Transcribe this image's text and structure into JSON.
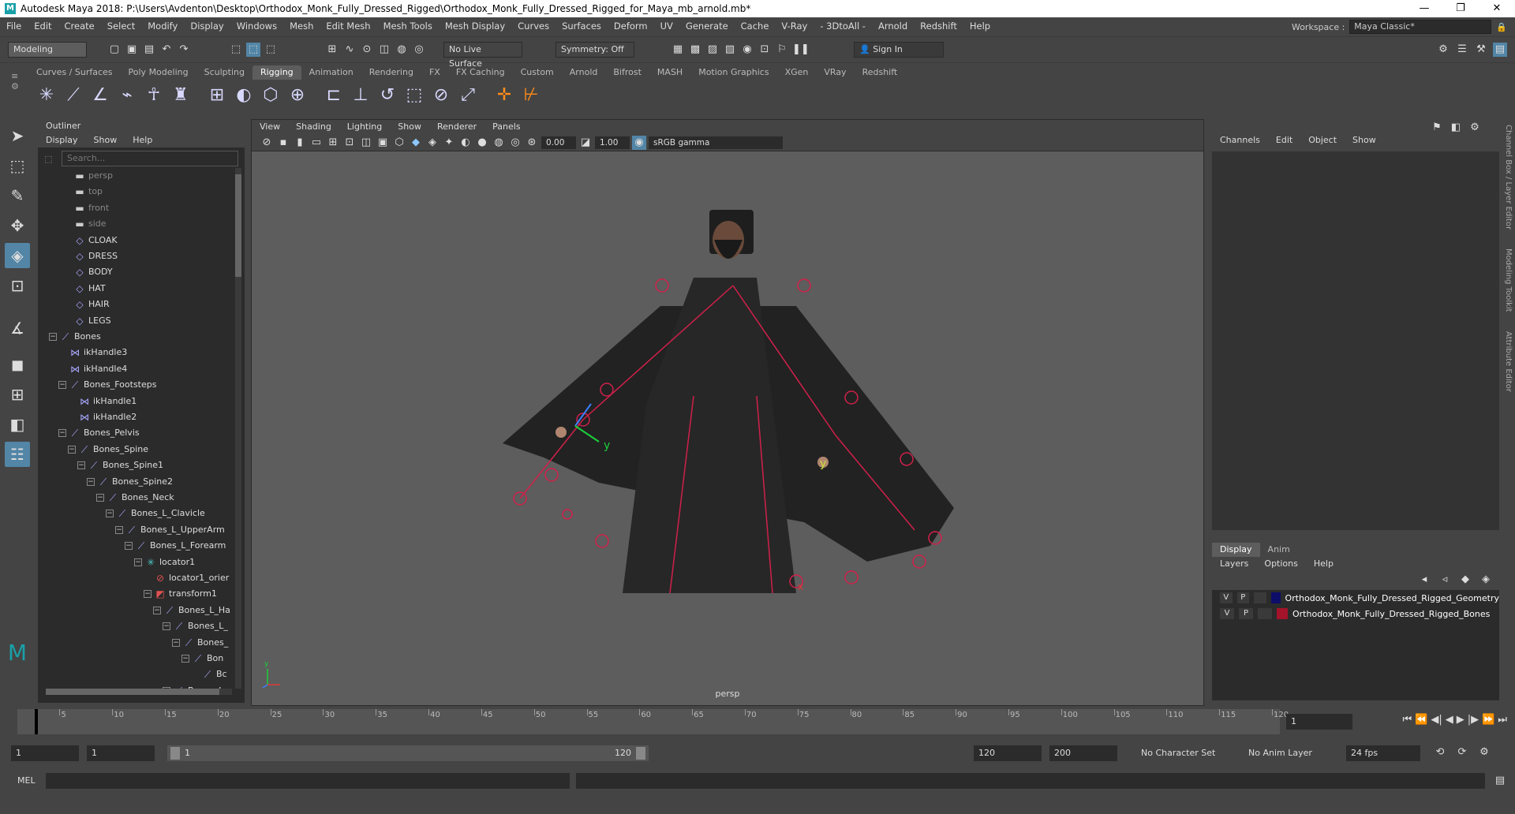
{
  "window": {
    "title": "Autodesk Maya 2018: P:\\Users\\Avdenton\\Desktop\\Orthodox_Monk_Fully_Dressed_Rigged\\Orthodox_Monk_Fully_Dressed_Rigged_for_Maya_mb_arnold.mb*",
    "minimize": "—",
    "maximize": "❐",
    "close": "✕"
  },
  "menubar": [
    "File",
    "Edit",
    "Create",
    "Select",
    "Modify",
    "Display",
    "Windows",
    "Mesh",
    "Edit Mesh",
    "Mesh Tools",
    "Mesh Display",
    "Curves",
    "Surfaces",
    "Deform",
    "UV",
    "Generate",
    "Cache",
    "V-Ray",
    "- 3DtoAll -",
    "Arnold",
    "Redshift",
    "Help"
  ],
  "workspace": {
    "label": "Workspace :",
    "value": "Maya Classic*"
  },
  "status": {
    "mode": "Modeling",
    "live_surface": "No Live Surface",
    "symmetry": "Symmetry: Off",
    "sign_in": "Sign In"
  },
  "shelf_tabs": [
    "Curves / Surfaces",
    "Poly Modeling",
    "Sculpting",
    "Rigging",
    "Animation",
    "Rendering",
    "FX",
    "FX Caching",
    "Custom",
    "Arnold",
    "Bifrost",
    "MASH",
    "Motion Graphics",
    "XGen",
    "VRay",
    "Redshift"
  ],
  "shelf_active": "Rigging",
  "outliner": {
    "title": "Outliner",
    "menu": [
      "Display",
      "Show",
      "Help"
    ],
    "search_placeholder": "Search...",
    "items": [
      {
        "label": "persp",
        "indent": 0,
        "kind": "camera"
      },
      {
        "label": "top",
        "indent": 0,
        "kind": "camera"
      },
      {
        "label": "front",
        "indent": 0,
        "kind": "camera"
      },
      {
        "label": "side",
        "indent": 0,
        "kind": "camera"
      },
      {
        "label": "CLOAK",
        "indent": 0,
        "kind": "mesh"
      },
      {
        "label": "DRESS",
        "indent": 0,
        "kind": "mesh"
      },
      {
        "label": "BODY",
        "indent": 0,
        "kind": "mesh"
      },
      {
        "label": "HAT",
        "indent": 0,
        "kind": "mesh"
      },
      {
        "label": "HAIR",
        "indent": 0,
        "kind": "mesh"
      },
      {
        "label": "LEGS",
        "indent": 0,
        "kind": "mesh"
      },
      {
        "label": "Bones",
        "indent": 0,
        "kind": "joint",
        "exp": "−"
      },
      {
        "label": "ikHandle3",
        "indent": 1,
        "kind": "ik"
      },
      {
        "label": "ikHandle4",
        "indent": 1,
        "kind": "ik"
      },
      {
        "label": "Bones_Footsteps",
        "indent": 1,
        "kind": "joint",
        "exp": "−"
      },
      {
        "label": "ikHandle1",
        "indent": 2,
        "kind": "ik"
      },
      {
        "label": "ikHandle2",
        "indent": 2,
        "kind": "ik"
      },
      {
        "label": "Bones_Pelvis",
        "indent": 1,
        "kind": "joint",
        "exp": "−"
      },
      {
        "label": "Bones_Spine",
        "indent": 2,
        "kind": "joint",
        "exp": "−"
      },
      {
        "label": "Bones_Spine1",
        "indent": 3,
        "kind": "joint",
        "exp": "−"
      },
      {
        "label": "Bones_Spine2",
        "indent": 4,
        "kind": "joint",
        "exp": "−"
      },
      {
        "label": "Bones_Neck",
        "indent": 5,
        "kind": "joint",
        "exp": "−"
      },
      {
        "label": "Bones_L_Clavicle",
        "indent": 6,
        "kind": "joint",
        "exp": "−"
      },
      {
        "label": "Bones_L_UpperArm",
        "indent": 7,
        "kind": "joint",
        "exp": "−"
      },
      {
        "label": "Bones_L_Forearm",
        "indent": 8,
        "kind": "joint",
        "exp": "−"
      },
      {
        "label": "locator1",
        "indent": 9,
        "kind": "locator",
        "exp": "−"
      },
      {
        "label": "locator1_orier",
        "indent": 10,
        "kind": "constraint"
      },
      {
        "label": "transform1",
        "indent": 10,
        "kind": "transform",
        "exp": "−"
      },
      {
        "label": "Bones_L_Ha",
        "indent": 11,
        "kind": "joint",
        "exp": "−"
      },
      {
        "label": "Bones_L_",
        "indent": 12,
        "kind": "joint",
        "exp": "−"
      },
      {
        "label": "Bones_",
        "indent": 13,
        "kind": "joint",
        "exp": "−"
      },
      {
        "label": "Bon",
        "indent": 14,
        "kind": "joint",
        "exp": "−"
      },
      {
        "label": "Bc",
        "indent": 15,
        "kind": "joint"
      },
      {
        "label": "Bones_L_",
        "indent": 12,
        "kind": "joint",
        "exp": "−"
      }
    ]
  },
  "viewport": {
    "menu": [
      "View",
      "Shading",
      "Lighting",
      "Show",
      "Renderer",
      "Panels"
    ],
    "exposure": "0.00",
    "gamma": "1.00",
    "color_space": "sRGB gamma",
    "camera_label": "persp",
    "axis_y": "y",
    "axis_x": "x"
  },
  "channelbox": {
    "menu": [
      "Channels",
      "Edit",
      "Object",
      "Show"
    ],
    "layer_tabs": [
      "Display",
      "Anim"
    ],
    "layer_menu": [
      "Layers",
      "Options",
      "Help"
    ],
    "layers": [
      {
        "v": "V",
        "p": "P",
        "color": "#0d0d6a",
        "name": "Orthodox_Monk_Fully_Dressed_Rigged_Geometry"
      },
      {
        "v": "V",
        "p": "P",
        "color": "#a3132a",
        "name": "Orthodox_Monk_Fully_Dressed_Rigged_Bones"
      }
    ]
  },
  "side_tabs": [
    "Channel Box / Layer Editor",
    "Modeling Toolkit",
    "Attribute Editor"
  ],
  "timeline": {
    "ticks": [
      "5",
      "10",
      "15",
      "20",
      "25",
      "30",
      "35",
      "40",
      "45",
      "50",
      "55",
      "60",
      "65",
      "70",
      "75",
      "80",
      "85",
      "90",
      "95",
      "100",
      "105",
      "110",
      "115",
      "120"
    ],
    "current_frame": "1"
  },
  "range": {
    "start": "1",
    "inner_start": "1",
    "slider_start": "1",
    "slider_end": "120",
    "end": "120",
    "outer_end": "200",
    "character_set": "No Character Set",
    "anim_layer": "No Anim Layer",
    "fps": "24 fps"
  },
  "command": {
    "lang": "MEL"
  }
}
